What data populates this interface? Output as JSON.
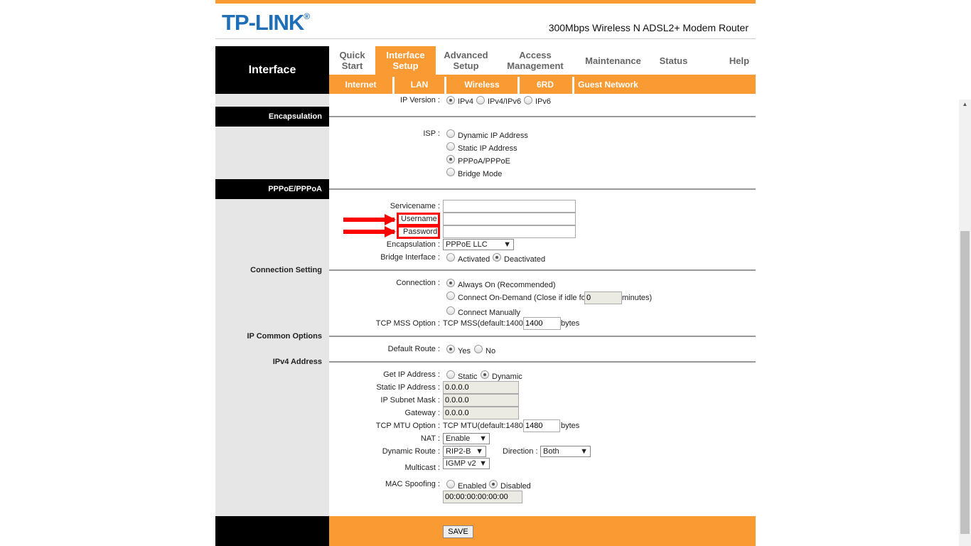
{
  "header": {
    "logo": "TP-LINK",
    "logo_mark": "®",
    "model": "300Mbps Wireless N ADSL2+ Modem Router",
    "section": "Interface"
  },
  "nav": {
    "tabs": [
      {
        "label": "Quick Start"
      },
      {
        "label": "Interface Setup",
        "active": true
      },
      {
        "label": "Advanced Setup"
      },
      {
        "label": "Access Management"
      },
      {
        "label": "Maintenance"
      },
      {
        "label": "Status"
      },
      {
        "label": "Help"
      }
    ],
    "subtabs": [
      "Internet",
      "LAN",
      "Wireless",
      "6RD",
      "Guest Network"
    ]
  },
  "colors": {
    "accent": "#f99a33",
    "brand": "#1f6fb8",
    "highlight": "#ff0000"
  },
  "form": {
    "ip_version": {
      "label": "IP Version :",
      "options": [
        "IPv4",
        "IPv4/IPv6",
        "IPv6"
      ],
      "selected": "IPv4"
    },
    "sections": {
      "encapsulation": "Encapsulation",
      "pppoe": "PPPoE/PPPoA",
      "connection": "Connection Setting",
      "ip_common": "IP Common Options",
      "ipv4": "IPv4 Address"
    },
    "isp": {
      "label": "ISP :",
      "options": [
        "Dynamic IP Address",
        "Static IP Address",
        "PPPoA/PPPoE",
        "Bridge Mode"
      ],
      "selected": "PPPoA/PPPoE"
    },
    "servicename": {
      "label": "Servicename :",
      "value": ""
    },
    "username": {
      "label": "Username",
      "colon": ":",
      "value": ""
    },
    "password": {
      "label": "Password",
      "colon": ":",
      "value": ""
    },
    "encap": {
      "label": "Encapsulation :",
      "value": "PPPoE LLC"
    },
    "bridge": {
      "label": "Bridge Interface :",
      "options": [
        "Activated",
        "Deactivated"
      ],
      "selected": "Deactivated"
    },
    "connection": {
      "label": "Connection :",
      "always": "Always On (Recommended)",
      "ondemand": "Connect On-Demand (Close if idle for",
      "idle": "0",
      "minutes": "minutes)",
      "manual": "Connect Manually",
      "selected": "always"
    },
    "mss": {
      "label": "TCP MSS Option :",
      "text": "TCP MSS(default:1400)",
      "value": "1400",
      "unit": "bytes"
    },
    "default_route": {
      "label": "Default Route :",
      "options": [
        "Yes",
        "No"
      ],
      "selected": "Yes"
    },
    "get_ip": {
      "label": "Get IP Address :",
      "options": [
        "Static",
        "Dynamic"
      ],
      "selected": "Dynamic"
    },
    "static_ip": {
      "label": "Static IP Address :",
      "value": "0.0.0.0"
    },
    "subnet": {
      "label": "IP Subnet Mask :",
      "value": "0.0.0.0"
    },
    "gateway": {
      "label": "Gateway :",
      "value": "0.0.0.0"
    },
    "mtu": {
      "label": "TCP MTU Option :",
      "text": "TCP MTU(default:1480)",
      "value": "1480",
      "unit": "bytes"
    },
    "nat": {
      "label": "NAT :",
      "value": "Enable"
    },
    "dyn_route": {
      "label": "Dynamic Route :",
      "value": "RIP2-B"
    },
    "direction": {
      "label": "Direction :",
      "value": "Both"
    },
    "multicast": {
      "label": "Multicast :",
      "value": "IGMP v2"
    },
    "mac": {
      "label": "MAC Spoofing :",
      "options": [
        "Enabled",
        "Disabled"
      ],
      "selected": "Disabled",
      "value": "00:00:00:00:00:00"
    },
    "save": "SAVE"
  }
}
